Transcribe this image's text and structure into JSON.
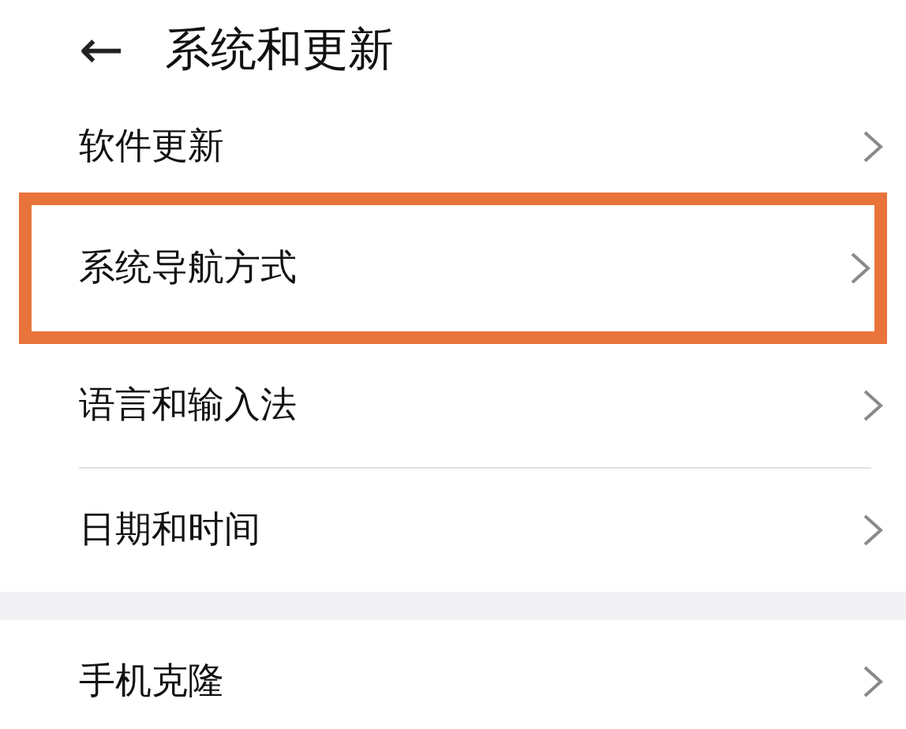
{
  "header": {
    "back": "←",
    "title": "系统和更新"
  },
  "groups": [
    {
      "items": [
        {
          "label": "软件更新",
          "highlighted": false
        },
        {
          "label": "系统导航方式",
          "highlighted": true
        },
        {
          "label": "语言和输入法",
          "highlighted": false
        },
        {
          "label": "日期和时间",
          "highlighted": false
        }
      ]
    },
    {
      "items": [
        {
          "label": "手机克隆",
          "highlighted": false
        }
      ]
    }
  ]
}
